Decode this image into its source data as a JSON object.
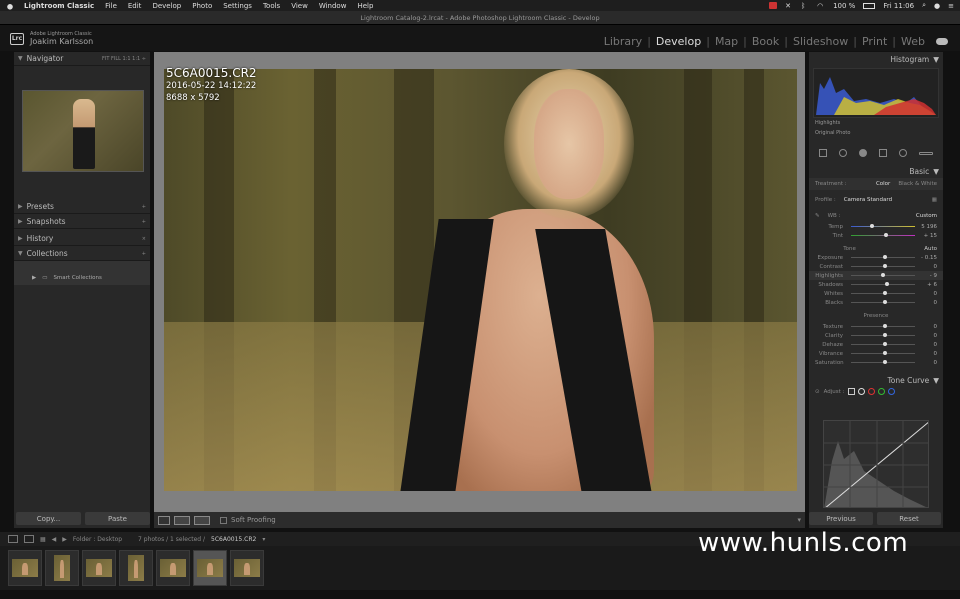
{
  "menubar": {
    "items": [
      "Lightroom Classic",
      "File",
      "Edit",
      "Develop",
      "Photo",
      "Settings",
      "Tools",
      "View",
      "Window",
      "Help"
    ],
    "battery": "100 %",
    "clock": "Fri 11:06"
  },
  "window": {
    "title": "Lightroom Catalog-2.lrcat - Adobe Photoshop Lightroom Classic - Develop"
  },
  "header": {
    "logo": "Lrc",
    "app_line": "Adobe Lightroom Classic",
    "user": "Joakim Karlsson",
    "modules": [
      "Library",
      "Develop",
      "Map",
      "Book",
      "Slideshow",
      "Print",
      "Web"
    ],
    "active_module": "Develop"
  },
  "left_panel": {
    "navigator": {
      "title": "Navigator",
      "zoom_options": "FIT  FILL  1:1  1:1 ÷"
    },
    "sections": [
      "Presets",
      "Snapshots",
      "History",
      "Collections"
    ],
    "smart_collections": "Smart Collections",
    "copy_label": "Copy...",
    "paste_label": "Paste"
  },
  "image_info": {
    "filename": "5C6A0015.CR2",
    "datetime": "2016-05-22 14:12:22",
    "dimensions": "8688 x 5792"
  },
  "toolbar": {
    "soft_proofing": "Soft Proofing"
  },
  "right_panel": {
    "histogram_title": "Histogram",
    "highlights_label": "Highlights",
    "original_photo": "Original Photo",
    "basic_title": "Basic",
    "treatment": {
      "label": "Treatment :",
      "color": "Color",
      "bw": "Black & White"
    },
    "profile": {
      "label": "Profile :",
      "value": "Camera Standard"
    },
    "wb": {
      "label": "WB :",
      "value": "Custom"
    },
    "temp": {
      "label": "Temp",
      "value": "5 196"
    },
    "tint": {
      "label": "Tint",
      "value": "+ 15"
    },
    "tone": {
      "label": "Tone",
      "auto": "Auto"
    },
    "sliders": [
      {
        "label": "Exposure",
        "value": "- 0.15",
        "pos": 0.5
      },
      {
        "label": "Contrast",
        "value": "0",
        "pos": 0.5
      },
      {
        "label": "Highlights",
        "value": "- 9",
        "pos": 0.47
      },
      {
        "label": "Shadows",
        "value": "+ 6",
        "pos": 0.53
      },
      {
        "label": "Whites",
        "value": "0",
        "pos": 0.5
      },
      {
        "label": "Blacks",
        "value": "0",
        "pos": 0.5
      }
    ],
    "presence_title": "Presence",
    "presence": [
      {
        "label": "Texture",
        "value": "0",
        "pos": 0.5
      },
      {
        "label": "Clarity",
        "value": "0",
        "pos": 0.5
      },
      {
        "label": "Dehaze",
        "value": "0",
        "pos": 0.5
      },
      {
        "label": "Vibrance",
        "value": "0",
        "pos": 0.5
      },
      {
        "label": "Saturation",
        "value": "0",
        "pos": 0.5
      }
    ],
    "tone_curve_title": "Tone Curve",
    "adjust_label": "Adjust :",
    "previous_label": "Previous",
    "reset_label": "Reset"
  },
  "filmstrip": {
    "folder": "Folder : Desktop",
    "count": "7 photos / 1 selected /",
    "current": "5C6A0015.CR2",
    "thumbs": 7,
    "selected_index": 5
  },
  "watermark": "www.hunls.com",
  "colors": {
    "active_module": "#dddddd",
    "panel_bg": "#282828",
    "canvas_bg": "#808080"
  }
}
